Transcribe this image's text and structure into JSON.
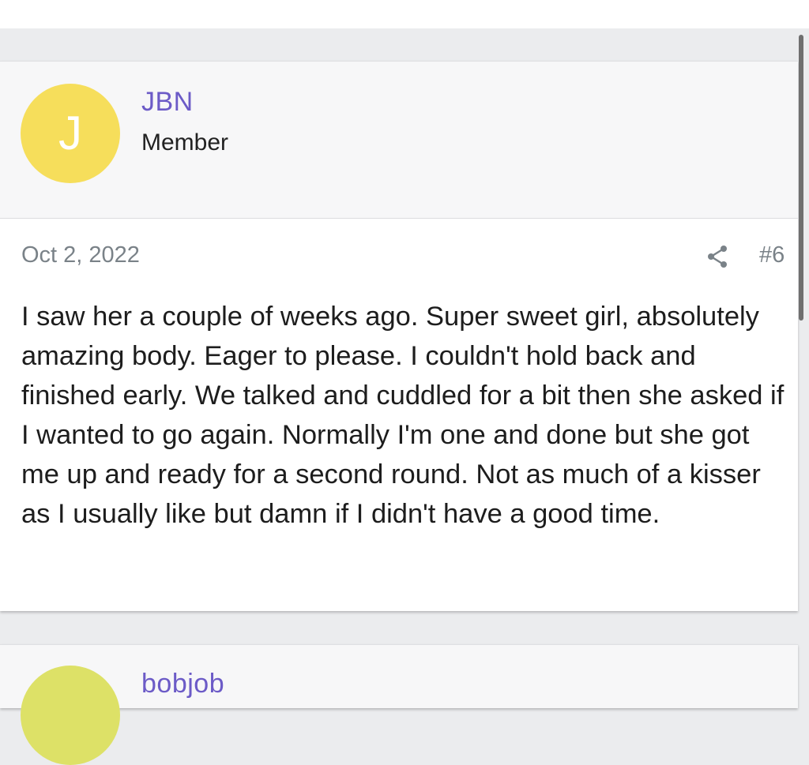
{
  "post1": {
    "avatar_letter": "J",
    "avatar_color": "#f6de5b",
    "username": "JBN",
    "role": "Member",
    "date": "Oct 2, 2022",
    "share_icon": "share-icon",
    "post_number": "#6",
    "body": "I saw her a couple of weeks ago. Super sweet girl, absolutely amazing body. Eager to please. I couldn't hold back and finished early. We talked and cuddled for a bit then she asked if I wanted to go again. Normally I'm one and done but she got me up and ready for a second round. Not as much of a kisser as I usually like but damn if I didn't have a good time."
  },
  "post2": {
    "avatar_color": "#dde167",
    "username": "bobjob"
  },
  "colors": {
    "username": "#6c5bc7",
    "meta": "#7a8288",
    "background": "#ebecee"
  }
}
